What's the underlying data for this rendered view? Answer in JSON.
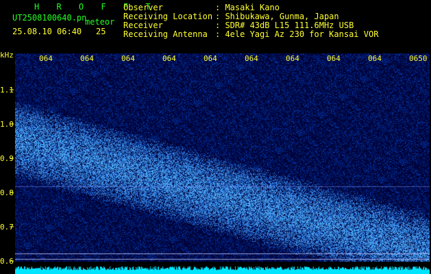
{
  "header": {
    "app_name": "H R O F F T",
    "filename": "UT2508100640.pn",
    "mode": "meteor",
    "datetime": "25.08.10 06:40",
    "count": "25",
    "fields": [
      {
        "label": "Observer",
        "value": ": Masaki Kano"
      },
      {
        "label": "Receiving Location",
        "value": ": Shibukawa, Gunma, Japan"
      },
      {
        "label": "Receiver",
        "value": ": SDR# 43dB L15 111.6MHz USB"
      },
      {
        "label": "Receiving Antenna",
        "value": ": 4ele Yagi Az 230 for Kansai VOR"
      }
    ]
  },
  "axis": {
    "y_unit": "kHz",
    "y_ticks": [
      "1.1",
      "1.0",
      "0.9",
      "0.8",
      "0.7",
      "0.6"
    ],
    "x_ticks": [
      "064",
      "064",
      "064",
      "064",
      "064",
      "064",
      "064",
      "064",
      "064",
      "0650"
    ]
  },
  "colors": {
    "background": "#00003a",
    "signal": "#3a64ff",
    "text_green": "#22ff22",
    "text_yellow": "#ffff33",
    "bar": "#00e5ff"
  }
}
